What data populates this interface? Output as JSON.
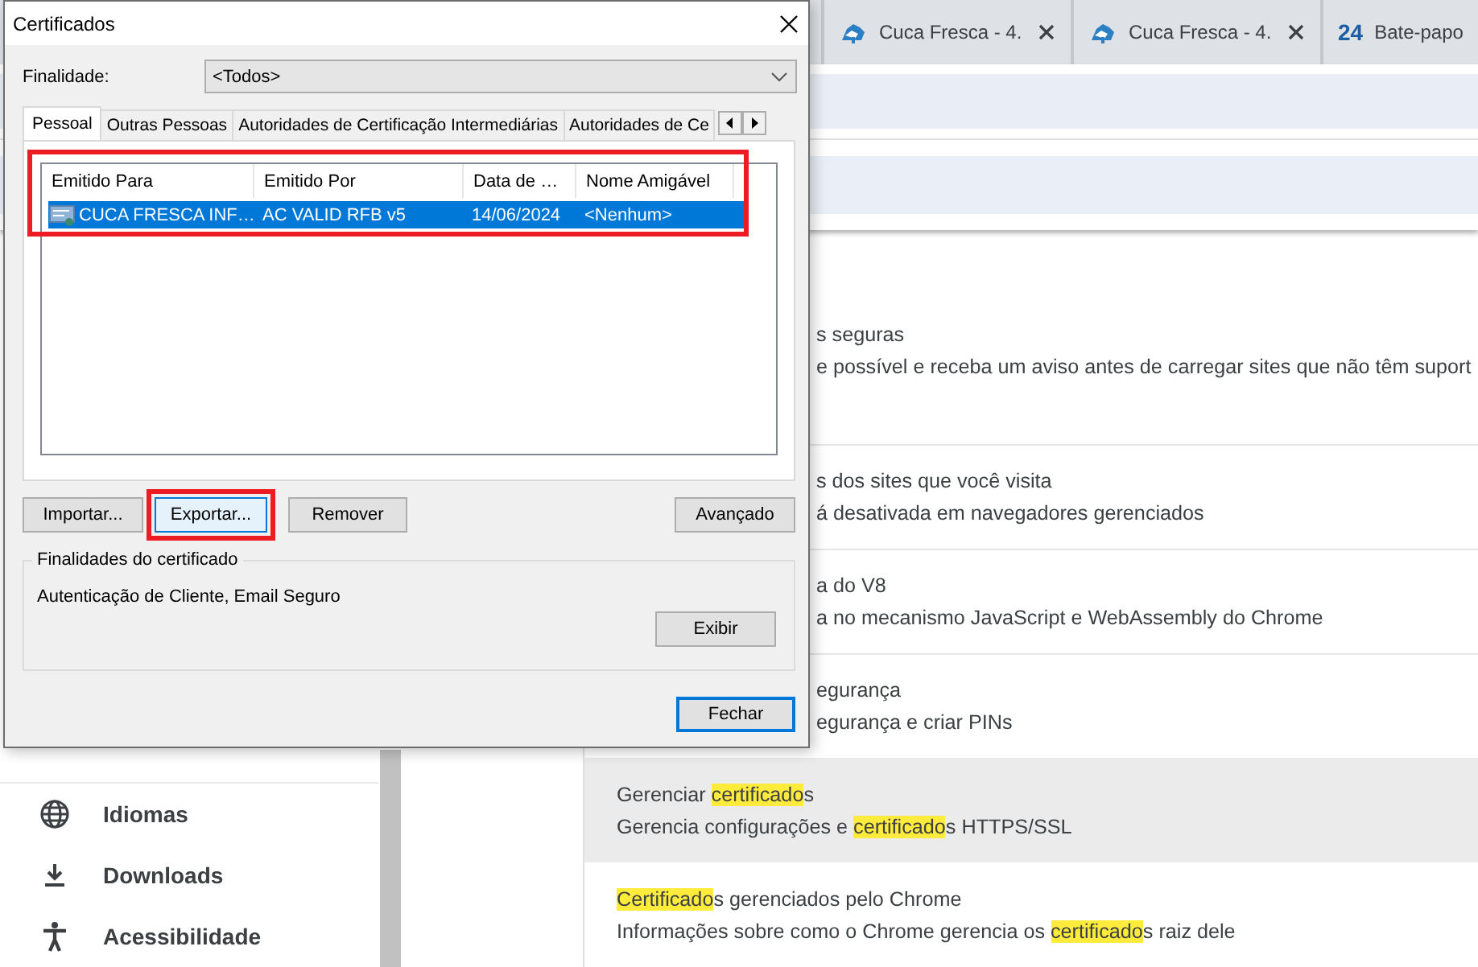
{
  "browser": {
    "tabs": [
      {
        "title": "Cuca Fresca - 4.",
        "closable": true
      },
      {
        "title": "Cuca Fresca - 4.",
        "closable": true
      },
      {
        "title": "Bate-papo",
        "favicon_text": "24",
        "closable": false
      }
    ],
    "sidebar": {
      "items": [
        {
          "label": "Idiomas"
        },
        {
          "label": "Downloads"
        },
        {
          "label": "Acessibilidade"
        }
      ]
    },
    "settings_rows": [
      {
        "kind": "partial",
        "hovered": false,
        "title": [
          {
            "text": "s seguras",
            "match": false
          }
        ],
        "description": [
          {
            "text": "e possível e receba um aviso antes de carregar sites que não têm suport",
            "match": false
          }
        ]
      },
      {
        "kind": "partial",
        "hovered": false,
        "title": [
          {
            "text": "s dos sites que você visita",
            "match": false
          }
        ],
        "description": [
          {
            "text": "á desativada em navegadores gerenciados",
            "match": false
          }
        ]
      },
      {
        "kind": "partial",
        "hovered": false,
        "title": [
          {
            "text": "a do V8",
            "match": false
          }
        ],
        "description": [
          {
            "text": "a no mecanismo JavaScript e WebAssembly do Chrome",
            "match": false
          }
        ]
      },
      {
        "kind": "partial",
        "hovered": false,
        "title": [
          {
            "text": "egurança",
            "match": false
          }
        ],
        "description": [
          {
            "text": "egurança e criar PINs",
            "match": false
          }
        ]
      },
      {
        "kind": "full",
        "hovered": true,
        "title": [
          {
            "text": "Gerenciar ",
            "match": false
          },
          {
            "text": "certificado",
            "match": true
          },
          {
            "text": "s",
            "match": false
          }
        ],
        "description": [
          {
            "text": "Gerencia configurações e ",
            "match": false
          },
          {
            "text": "certificado",
            "match": true
          },
          {
            "text": "s HTTPS/SSL",
            "match": false
          }
        ]
      },
      {
        "kind": "full",
        "hovered": false,
        "title": [
          {
            "text": "Certificado",
            "match": true
          },
          {
            "text": "s gerenciados pelo Chrome",
            "match": false
          }
        ],
        "description": [
          {
            "text": "Informações sobre como o Chrome gerencia os ",
            "match": false
          },
          {
            "text": "certificado",
            "match": true
          },
          {
            "text": "s raiz dele",
            "match": false
          }
        ]
      }
    ]
  },
  "dialog": {
    "title": "Certificados",
    "purpose_label": "Finalidade:",
    "purpose_value": "<Todos>",
    "tabs": [
      {
        "label": "Pessoal",
        "selected": true
      },
      {
        "label": "Outras Pessoas",
        "selected": false
      },
      {
        "label": "Autoridades de Certificação Intermediárias",
        "selected": false
      },
      {
        "label": "Autoridades de Ce",
        "selected": false
      }
    ],
    "list": {
      "annotated": true,
      "columns": [
        "Emitido Para",
        "Emitido Por",
        "Data de …",
        "Nome Amigável"
      ],
      "rows": [
        {
          "selected": true,
          "cells": [
            "CUCA FRESCA INF…",
            "AC VALID RFB v5",
            "14/06/2024",
            "<Nenhum>"
          ]
        }
      ]
    },
    "buttons": [
      {
        "label": "Importar...",
        "hovered": false,
        "annotated": false
      },
      {
        "label": "Exportar...",
        "hovered": true,
        "annotated": true
      },
      {
        "label": "Remover",
        "hovered": false,
        "annotated": false
      }
    ],
    "advanced_button": "Avançado",
    "group": {
      "title": "Finalidades do certificado",
      "text": "Autenticação de Cliente, Email Seguro",
      "button": "Exibir"
    },
    "close_button": {
      "label": "Fechar",
      "default": true
    }
  }
}
